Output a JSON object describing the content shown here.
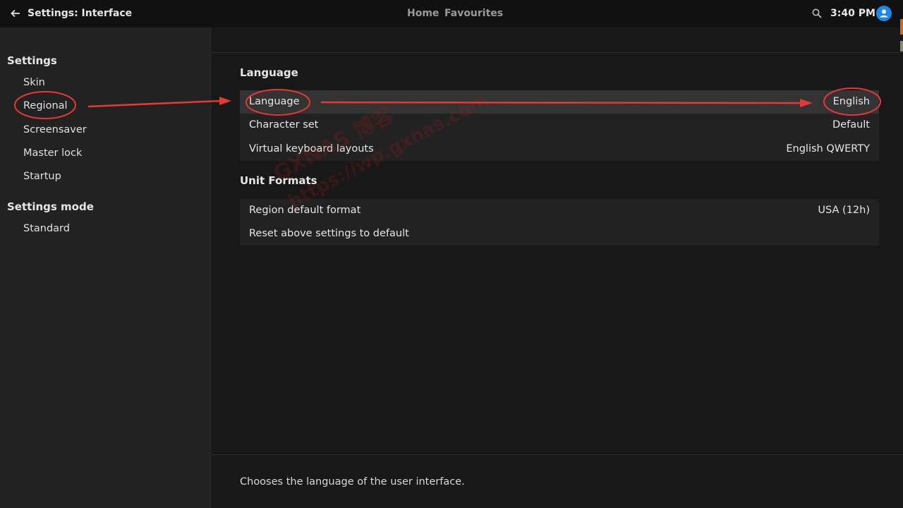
{
  "header": {
    "title": "Settings: Interface",
    "nav_home": "Home",
    "nav_favourites": "Favourites",
    "time": "3:40 PM"
  },
  "sidebar": {
    "settings_heading": "Settings",
    "items": [
      {
        "label": "Skin"
      },
      {
        "label": "Regional"
      },
      {
        "label": "Screensaver"
      },
      {
        "label": "Master lock"
      },
      {
        "label": "Startup"
      }
    ],
    "mode_heading": "Settings mode",
    "mode_value": "Standard"
  },
  "main": {
    "language_section": {
      "title": "Language",
      "rows": [
        {
          "label": "Language",
          "value": "English"
        },
        {
          "label": "Character set",
          "value": "Default"
        },
        {
          "label": "Virtual keyboard layouts",
          "value": "English QWERTY"
        }
      ]
    },
    "unit_section": {
      "title": "Unit Formats",
      "rows": [
        {
          "label": "Region default format",
          "value": "USA (12h)"
        },
        {
          "label": "Reset above settings to default",
          "value": ""
        }
      ]
    },
    "description": "Chooses the language of the user interface."
  },
  "watermark": {
    "line1": "GXNAS 博客",
    "line2": "https://wp.gxnas.com"
  },
  "colors": {
    "annotation": "#e53935",
    "accent": "#1e88e5"
  }
}
